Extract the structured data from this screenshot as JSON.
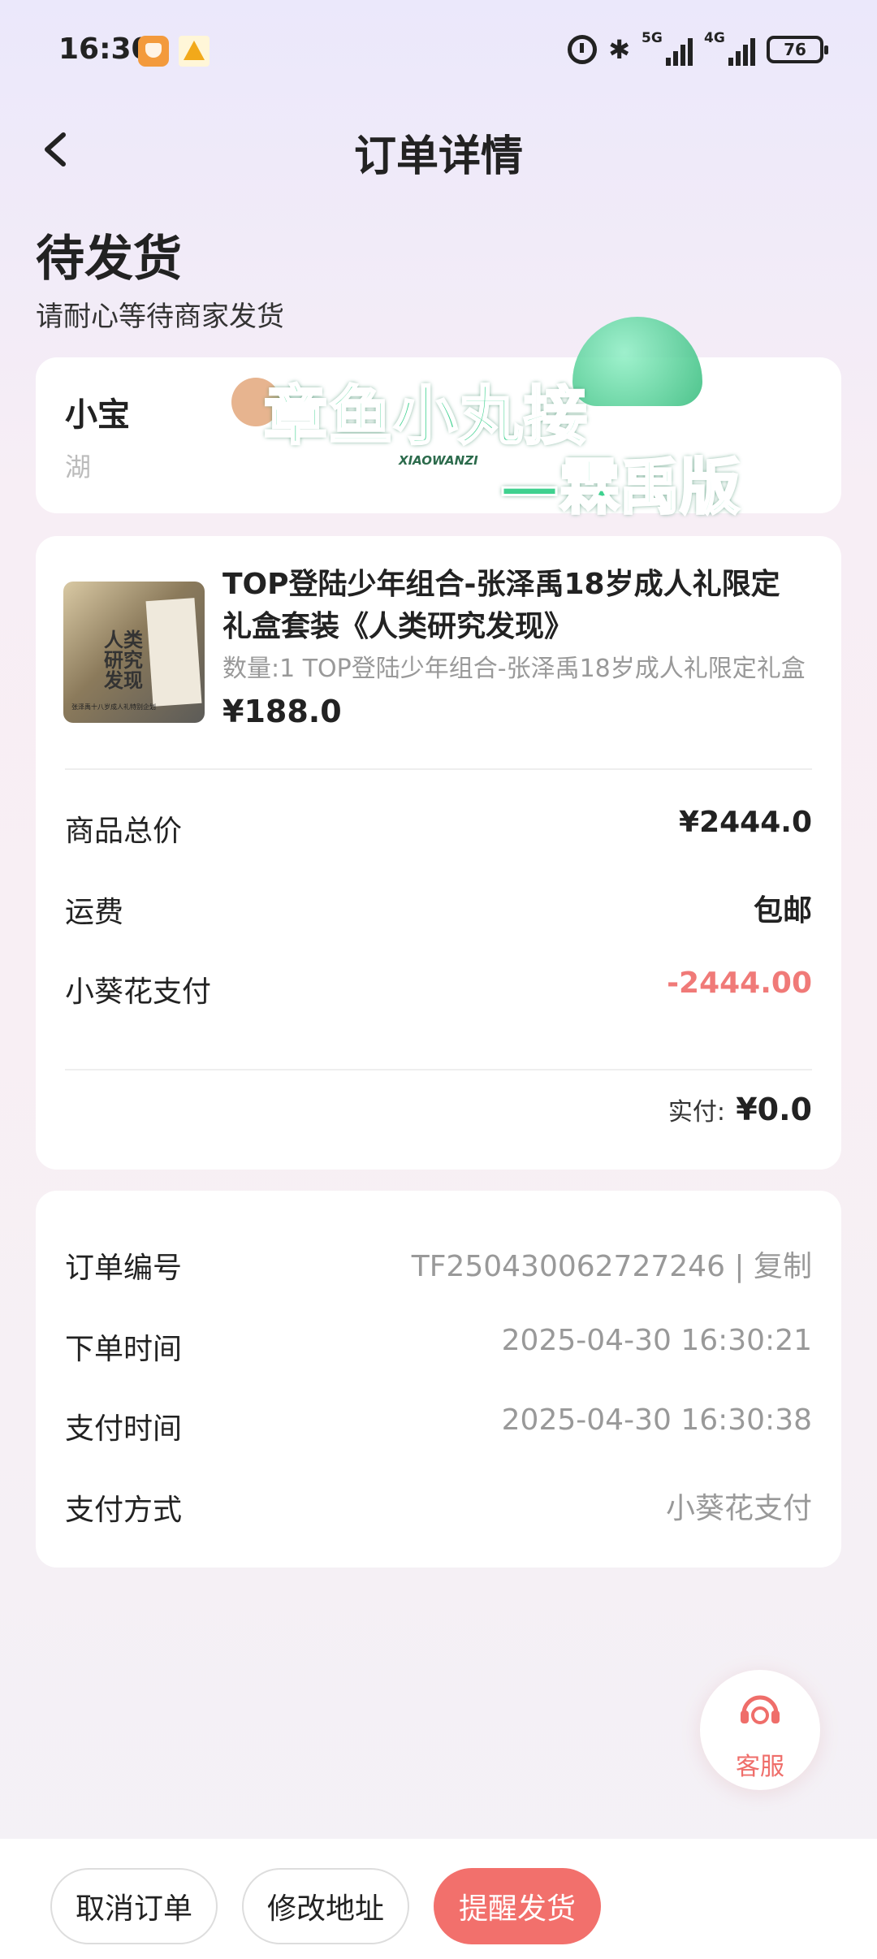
{
  "status_bar": {
    "time": "16:30",
    "network_1": "5G",
    "network_2": "4G",
    "battery": "76"
  },
  "header": {
    "title": "订单详情"
  },
  "order_status": {
    "title": "待发货",
    "subtitle": "请耐心等待商家发货"
  },
  "address": {
    "name": "小宝",
    "line": "湖"
  },
  "watermark": {
    "line1": "章鱼小丸接",
    "sub": "XIAOWANZI",
    "line2": "—霖禹版"
  },
  "product": {
    "name": "TOP登陆少年组合-张泽禹18岁成人礼限定礼盒套装《人类研究发现》",
    "spec": "数量:1 TOP登陆少年组合-张泽禹18岁成人礼限定礼盒",
    "price": "¥188.0",
    "thumb_text": "人类研究发现",
    "thumb_caption": "张泽禹十八岁成人礼特别企划"
  },
  "price_rows": [
    {
      "label": "商品总价",
      "value": "¥2444.0"
    },
    {
      "label": "运费",
      "value": "包邮"
    },
    {
      "label": "小葵花支付",
      "value": "-2444.00"
    }
  ],
  "paid": {
    "label": "实付:",
    "value": "¥0.0"
  },
  "order_info": [
    {
      "label": "订单编号",
      "value": "TF250430062727246 | 复制"
    },
    {
      "label": "下单时间",
      "value": "2025-04-30 16:30:21"
    },
    {
      "label": "支付时间",
      "value": "2025-04-30 16:30:38"
    },
    {
      "label": "支付方式",
      "value": "小葵花支付"
    }
  ],
  "customer_service": {
    "label": "客服"
  },
  "actions": {
    "cancel": "取消订单",
    "modify_address": "修改地址",
    "remind": "提醒发货"
  },
  "colors": {
    "accent": "#f2706c",
    "discount": "#f07a78",
    "muted": "#999999"
  }
}
